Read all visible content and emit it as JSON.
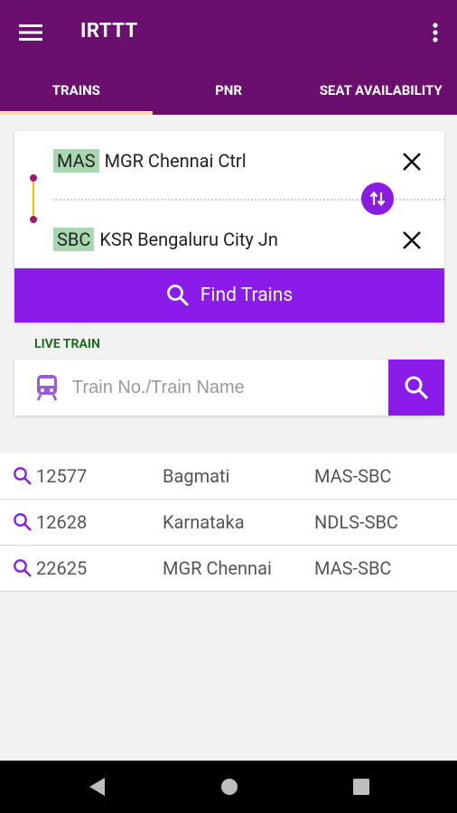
{
  "app": {
    "title": "IRTTT",
    "icons": {
      "menu": "hamburger-menu-icon",
      "more": "more-vert-icon"
    }
  },
  "tabs": [
    {
      "label": "TRAINS",
      "active": true
    },
    {
      "label": "PNR",
      "active": false
    },
    {
      "label": "SEAT AVAILABILITY",
      "active": false
    }
  ],
  "route": {
    "from": {
      "code": "MAS",
      "name": "MGR Chennai Ctrl"
    },
    "to": {
      "code": "SBC",
      "name": "KSR Bengaluru City Jn"
    },
    "icons": {
      "clear": "close-icon",
      "swap": "swap-vertical-icon"
    }
  },
  "find_trains": {
    "label": "Find Trains",
    "icon": "search-icon"
  },
  "live_train": {
    "label": "LIVE TRAIN",
    "placeholder": "Train No./Train Name",
    "value": "",
    "icons": {
      "train": "train-icon",
      "search": "search-icon"
    }
  },
  "recent": [
    {
      "number": "12577",
      "name": "Bagmati",
      "route": "MAS-SBC"
    },
    {
      "number": "12628",
      "name": "Karnataka",
      "route": "NDLS-SBC"
    },
    {
      "number": "22625",
      "name": "MGR Chennai",
      "route": "MAS-SBC"
    }
  ],
  "system_nav": {
    "icons": [
      "back-triangle-icon",
      "home-circle-icon",
      "recents-square-icon"
    ]
  },
  "colors": {
    "primary": "#6b0f6f",
    "accent": "#8a1be8",
    "tab_indicator": "#ffd8b0",
    "station_code_bg": "#a8d8b0",
    "live_train_label": "#1e6b1e"
  }
}
